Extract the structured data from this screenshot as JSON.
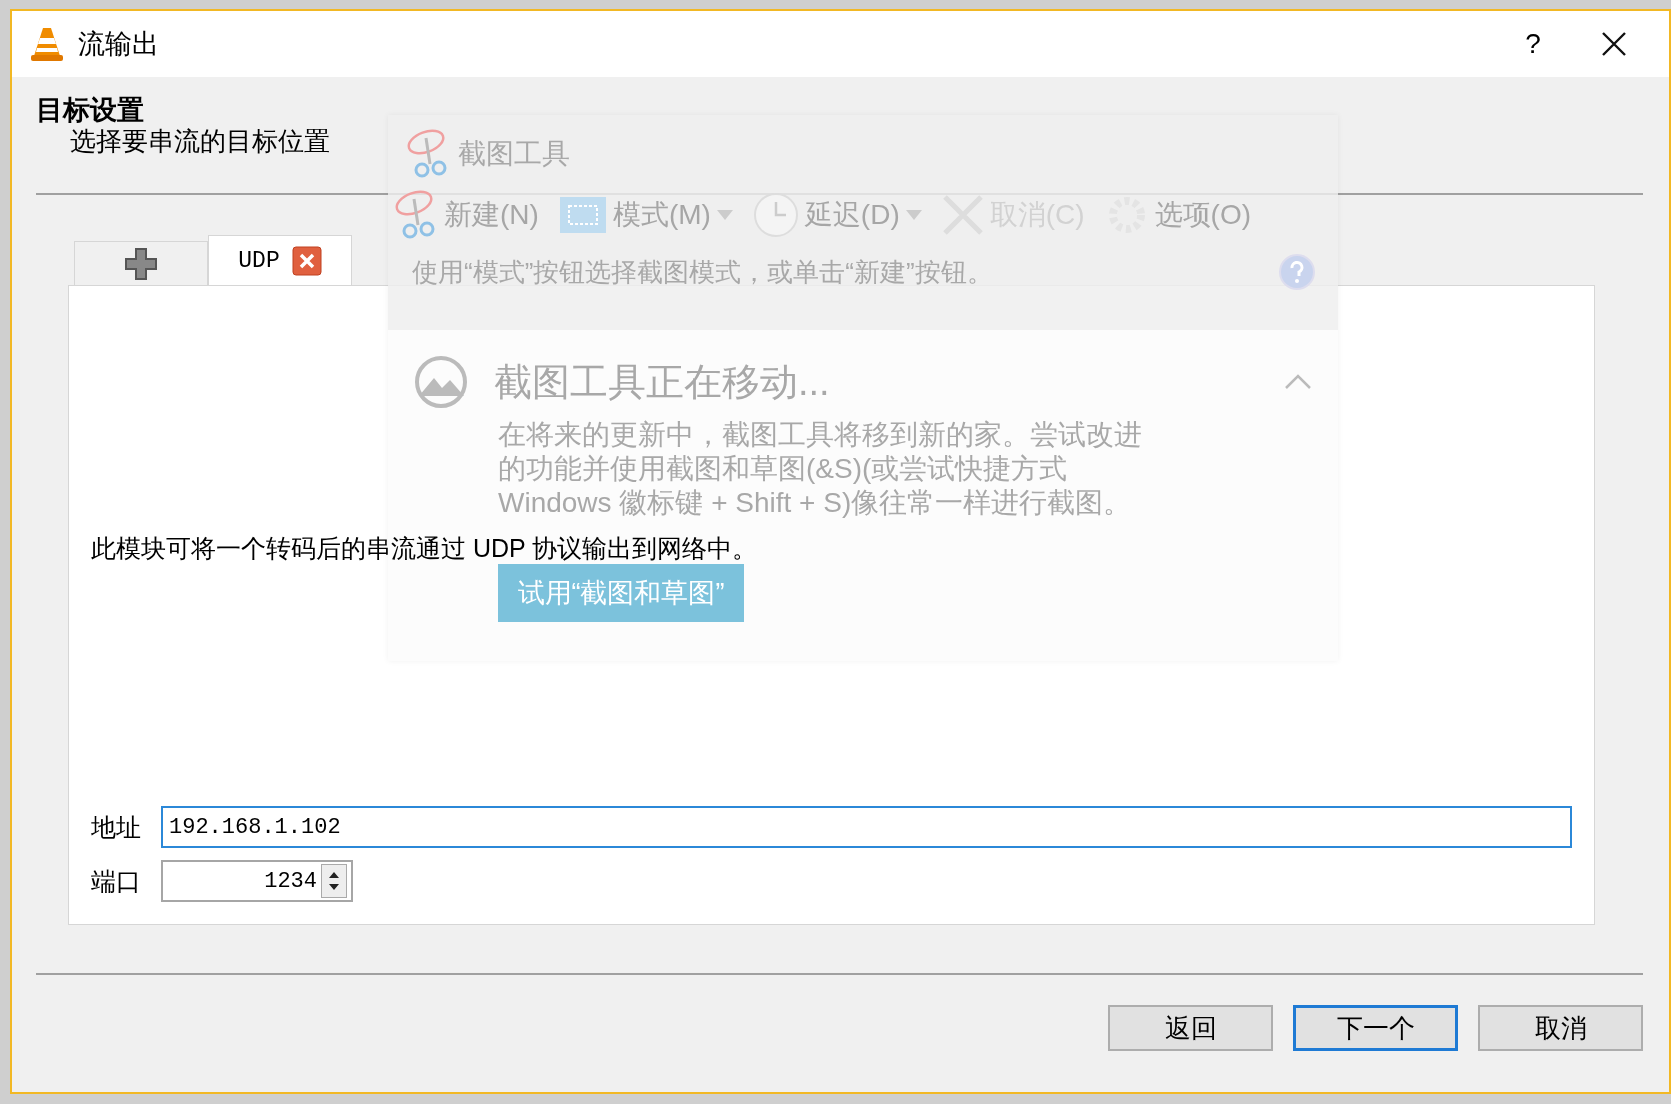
{
  "window": {
    "title": "流输出",
    "help_button": "?"
  },
  "header": {
    "title": "目标设置",
    "subtitle": "选择要串流的目标位置"
  },
  "tabs": [
    {
      "kind": "add",
      "selected": false,
      "closable": false
    },
    {
      "kind": "destination",
      "label": "UDP",
      "selected": true,
      "closable": true
    }
  ],
  "panel": {
    "description": "此模块可将一个转码后的串流通过 UDP 协议输出到网络中。",
    "fields": [
      {
        "kind": "text",
        "label": "地址",
        "value": "192.168.1.102",
        "focused": true
      },
      {
        "kind": "spin",
        "label": "端口",
        "value": "1234",
        "focused": false
      }
    ]
  },
  "buttons": [
    {
      "label": "返回",
      "default": false
    },
    {
      "label": "下一个",
      "default": true
    },
    {
      "label": "取消",
      "default": false
    }
  ],
  "overlay": {
    "title": "截图工具",
    "toolbar": [
      {
        "kind": "new",
        "label": "新建(N)",
        "dropdown": false,
        "disabled": false
      },
      {
        "kind": "mode",
        "label": "模式(M)",
        "dropdown": true,
        "disabled": false
      },
      {
        "kind": "delay",
        "label": "延迟(D)",
        "dropdown": true,
        "disabled": false
      },
      {
        "kind": "cancel",
        "label": "取消(C)",
        "dropdown": false,
        "disabled": true
      },
      {
        "kind": "options",
        "label": "选项(O)",
        "dropdown": false,
        "disabled": false
      }
    ],
    "hint": "使用“模式”按钮选择截图模式，或单击“新建”按钮。",
    "notice": {
      "title": "截图工具正在移动...",
      "body": "在将来的更新中，截图工具将移到新的家。尝试改进的功能并使用截图和草图(&S)(或尝试快捷方式 Windows 徽标键 + Shift + S)像往常一样进行截图。",
      "button": "试用“截图和草图”",
      "expanded": true
    }
  }
}
